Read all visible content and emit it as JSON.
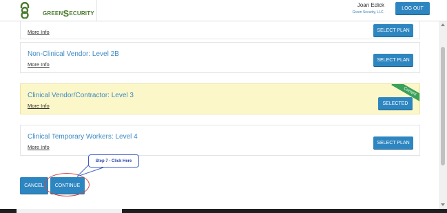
{
  "header": {
    "logo_left": "GREEN",
    "logo_s": "S",
    "logo_right": "ECURITY",
    "user_name": "Joan Edick",
    "company": "Green Security, LLC.",
    "logout_label": "LOG OUT"
  },
  "plans": [
    {
      "title": "",
      "link": "More Info",
      "button": "SELECT PLAN",
      "current": false
    },
    {
      "title": "Non-Clinical Vendor: Level 2B",
      "link": "More Info",
      "button": "SELECT PLAN",
      "current": false
    },
    {
      "title": "Clinical Vendor/Contractor: Level 3",
      "link": "More Info",
      "button": "SELECTED",
      "current": true,
      "ribbon": "Current"
    },
    {
      "title": "Clinical Temporary Workers: Level 4",
      "link": "More Info",
      "button": "SELECT PLAN",
      "current": false
    }
  ],
  "actions": {
    "cancel": "CANCEL",
    "continue": "CONTINUE"
  },
  "callout": "Step 7 - Click Here",
  "colors": {
    "accent": "#2e86c1",
    "highlight": "#fcf7c8",
    "ribbon": "#3aa15a",
    "annotation": "#d84444"
  },
  "icons": {
    "logo": "green-security-logo-icon"
  }
}
